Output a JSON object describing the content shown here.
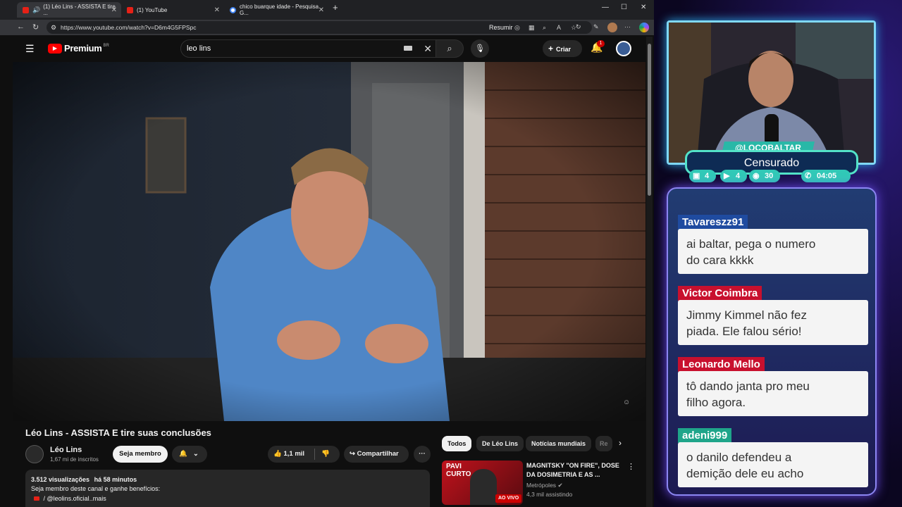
{
  "browser": {
    "tabs": [
      {
        "label": "(1) Léo Lins - ASSISTA E tire ..."
      },
      {
        "label": "(1) YouTube"
      },
      {
        "label": "chico buarque idade - Pesquisa G..."
      }
    ],
    "url": "https://www.youtube.com/watch?v=D6m4G5FPSpc",
    "resumir": "Resumir"
  },
  "youtube": {
    "brand": "Premium",
    "brand_sup": "BR",
    "search_value": "leo lins",
    "notif_count": "1",
    "create_label": "Criar",
    "video_title": "Léo Lins - ASSISTA E tire suas conclusões",
    "channel_name": "Léo Lins",
    "subscribers": "1,67 mi de inscritos",
    "join_label": "Seja membro",
    "likes": "1,1 mil",
    "share_label": "Compartilhar",
    "views": "3.512 visualizações",
    "time_ago": "há 58 minutos",
    "desc_line": "Seja membro deste canal e ganhe benefícios:",
    "desc_link": "/ @leolins.oficial",
    "desc_more": "..mais",
    "chips": [
      "Todos",
      "De Léo Lins",
      "Notícias mundiais",
      "Re"
    ],
    "rec": {
      "thumb_text_top": "PAVI",
      "thumb_text_bottom": "CURTO",
      "live_label": "AO VIVO",
      "title_1": "MAGNITSKY \"ON FIRE\", DOSE",
      "title_2": "DA DOSIMETRIA E AS ...",
      "channel": "Metrópoles",
      "watching": "4,3 mil assistindo"
    }
  },
  "stream": {
    "handle": "@LOCOBALTAR",
    "status": "Censurado",
    "stats": {
      "twitch": "4",
      "youtube": "4",
      "tips": "30",
      "time": "04:05"
    },
    "chat": [
      {
        "user": "Tavareszz91",
        "color": "#1f4ba0",
        "lines": [
          "ai baltar, pega o numero",
          "do cara kkkk"
        ]
      },
      {
        "user": "Victor Coimbra",
        "color": "#c8102e",
        "lines": [
          "Jimmy Kimmel não fez",
          "piada. Ele falou sério!"
        ]
      },
      {
        "user": "Leonardo Mello",
        "color": "#c8102e",
        "lines": [
          "tô dando janta pro meu",
          "filho agora."
        ]
      },
      {
        "user": "adeni999",
        "color": "#1fa58a",
        "lines": [
          "o danilo defendeu a",
          "demição dele eu acho"
        ]
      }
    ]
  }
}
